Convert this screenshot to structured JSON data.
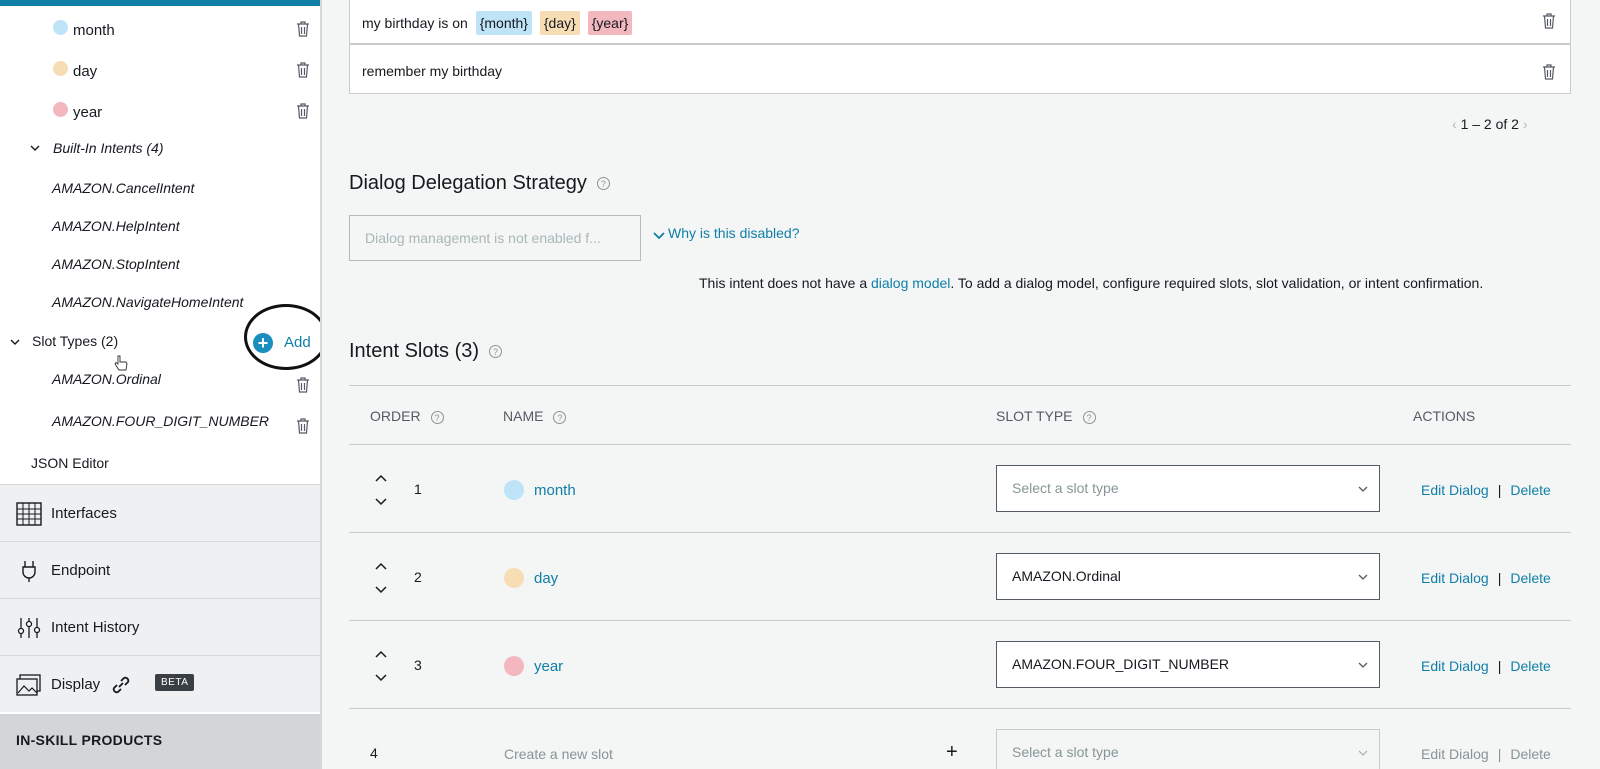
{
  "sidebar": {
    "slots": [
      {
        "label": "month",
        "color": "#bfe3f7"
      },
      {
        "label": "day",
        "color": "#f6ddb3"
      },
      {
        "label": "year",
        "color": "#f2b7bf"
      }
    ],
    "builtin_header": "Built-In Intents (4)",
    "builtin_intents": [
      "AMAZON.CancelIntent",
      "AMAZON.HelpIntent",
      "AMAZON.StopIntent",
      "AMAZON.NavigateHomeIntent"
    ],
    "slot_types_header": "Slot Types (2)",
    "add_label": "Add",
    "slot_types": [
      "AMAZON.Ordinal",
      "AMAZON.FOUR_DIGIT_NUMBER"
    ],
    "json_editor": "JSON Editor",
    "nav": {
      "interfaces": "Interfaces",
      "endpoint": "Endpoint",
      "intent_history": "Intent History",
      "display": "Display",
      "beta": "BETA",
      "in_skill_products": "IN-SKILL PRODUCTS"
    }
  },
  "utterances": {
    "items": [
      {
        "prefix": "my birthday is on",
        "chips": [
          {
            "text": "{month}",
            "color": "#bfe3f7"
          },
          {
            "text": "{day}",
            "color": "#f6ddb3"
          },
          {
            "text": "{year}",
            "color": "#f2b7bf"
          }
        ]
      },
      {
        "prefix": "remember my birthday",
        "chips": []
      }
    ],
    "pager": "1 – 2 of 2"
  },
  "dialog": {
    "title": "Dialog Delegation Strategy",
    "help": "?",
    "dropdown_text": "Dialog management is not enabled f...",
    "why_label": "Why is this disabled?",
    "desc_before": "This intent does not have a",
    "desc_link": "dialog model",
    "desc_after": ". To add a dialog model, configure required slots, slot validation, or intent confirmation."
  },
  "slots_table": {
    "title": "Intent Slots (3)",
    "headers": {
      "order": "ORDER",
      "name": "NAME",
      "slot_type": "SLOT TYPE",
      "actions": "ACTIONS"
    },
    "rows": [
      {
        "order": "1",
        "name": "month",
        "color": "#bfe3f7",
        "slot_type": "Select a slot type",
        "placeholder": true
      },
      {
        "order": "2",
        "name": "day",
        "color": "#f6ddb3",
        "slot_type": "AMAZON.Ordinal",
        "placeholder": false
      },
      {
        "order": "3",
        "name": "year",
        "color": "#f2b7bf",
        "slot_type": "AMAZON.FOUR_DIGIT_NUMBER",
        "placeholder": false
      }
    ],
    "edit_label": "Edit Dialog",
    "delete_label": "Delete",
    "separator": "|",
    "new_row": {
      "order": "4",
      "placeholder": "Create a new slot",
      "plus": "+",
      "slot_type": "Select a slot type"
    }
  },
  "colors": {
    "accent": "#0f7fa8",
    "topbar": "#0f7fa8"
  }
}
